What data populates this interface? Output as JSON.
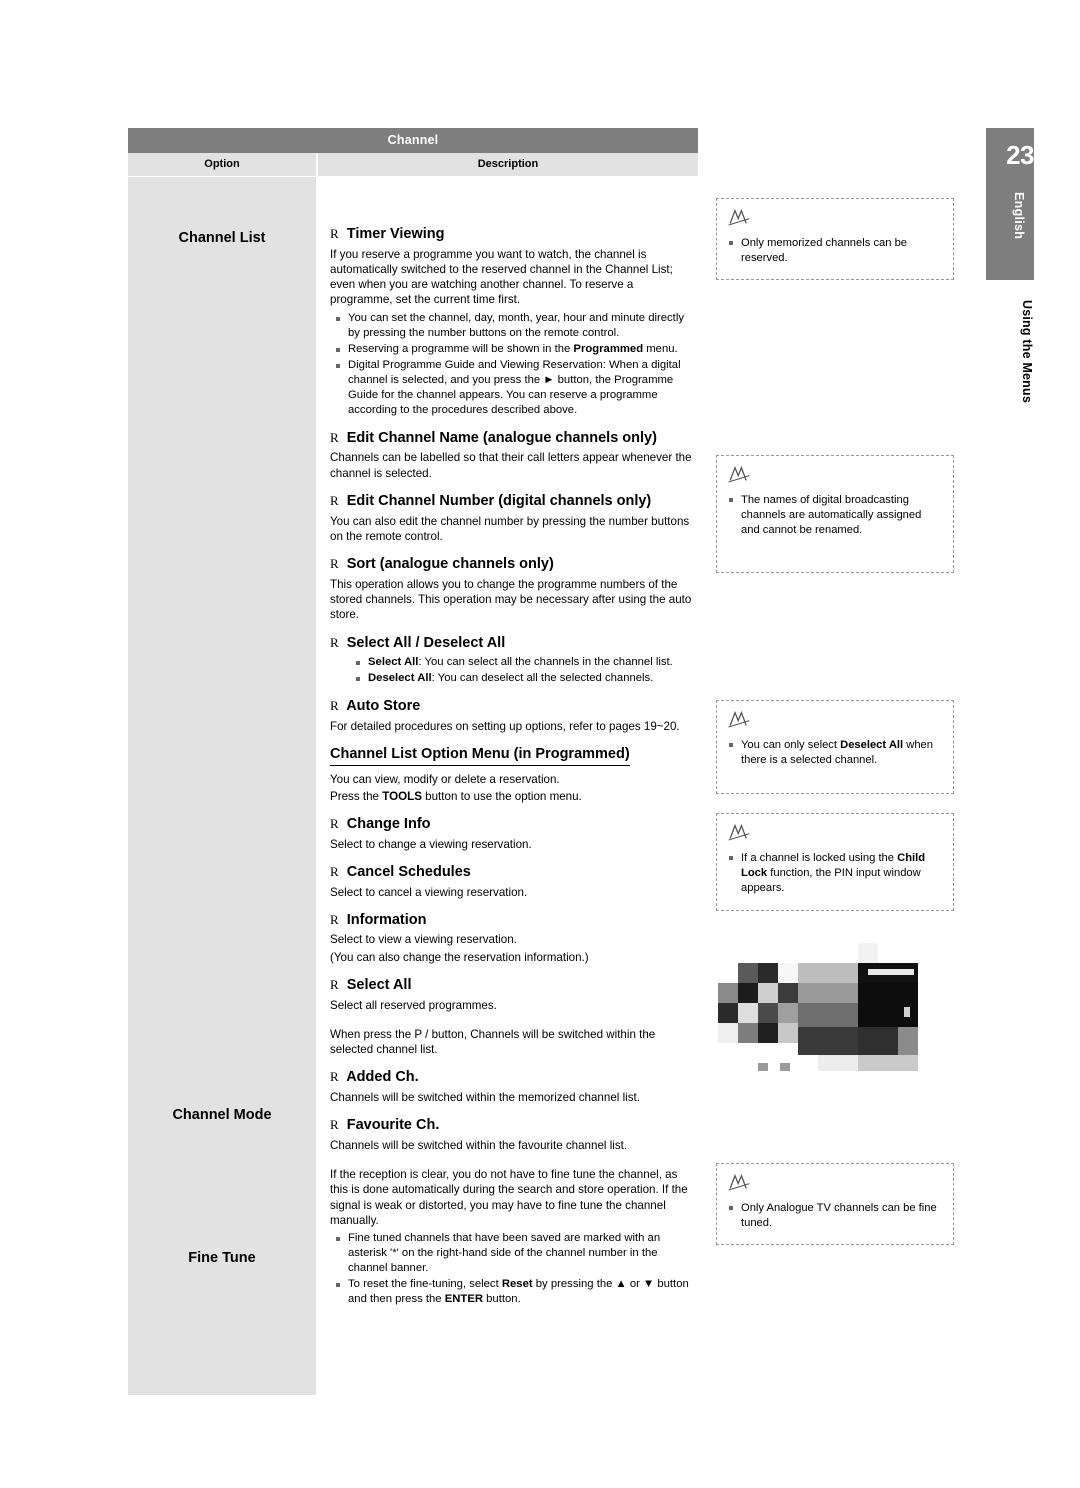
{
  "page": {
    "number": "23",
    "side_label": "English",
    "side_vertical": "Using the Menus"
  },
  "table": {
    "title": "Channel",
    "columns": {
      "option": "Option",
      "description": "Description"
    },
    "rows": [
      {
        "option": "Channel List"
      },
      {
        "option": "Channel Mode"
      },
      {
        "option": "Fine Tune"
      }
    ]
  },
  "content": {
    "timer_viewing": {
      "heading": "Timer Viewing",
      "paragraph": "If you reserve a programme you want to watch, the channel is automatically switched to the reserved channel in the Channel List; even when you are watching another channel. To reserve a programme, set the current time first.",
      "bullets": [
        "You can set the channel, day, month, year, hour and minute directly by pressing the number buttons on the remote control.",
        "Reserving a programme will be shown in the Programmed menu.",
        "Digital Programme Guide and Viewing Reservation: When a digital channel is selected, and you press the ► button, the Programme Guide for the channel appears. You can reserve a programme according to the procedures described above."
      ]
    },
    "edit_channel_name": {
      "heading": "Edit Channel Name (analogue channels only)",
      "paragraph": "Channels can be labelled so that their call letters appear whenever the channel is selected."
    },
    "edit_channel_number": {
      "heading": "Edit Channel Number (digital channels only)",
      "paragraph": "You can also edit the channel number by pressing the number buttons on the remote control."
    },
    "sort": {
      "heading": "Sort (analogue channels only)",
      "paragraph": "This operation allows you to change the programme numbers of the stored channels. This operation may be necessary after using the auto store."
    },
    "select_deselect_all": {
      "heading": "Select All / Deselect All",
      "bullets": [
        "Select All: You can select all the channels in the channel list.",
        "Deselect All: You can deselect all the selected channels."
      ]
    },
    "auto_store": {
      "heading": "Auto Store",
      "paragraph": "For detailed procedures on setting up options, refer to pages 19~20."
    },
    "option_menu": {
      "heading": "Channel List Option Menu (in Programmed)",
      "paragraph1": "You can view, modify or delete a reservation.",
      "paragraph2": "Press the TOOLS button to use the option menu."
    },
    "change_info": {
      "heading": "Change Info",
      "paragraph": "Select to change a viewing reservation."
    },
    "cancel_schedules": {
      "heading": "Cancel Schedules",
      "paragraph": "Select to cancel a viewing reservation."
    },
    "information": {
      "heading": "Information",
      "paragraph1": "Select to view a viewing reservation.",
      "paragraph2": "(You can also change the reservation information.)"
    },
    "select_all": {
      "heading": "Select All",
      "paragraph": "Select all reserved programmes."
    },
    "channel_mode": {
      "paragraph": "When press the P  /  button, Channels will be switched within the selected channel list.",
      "added_ch": {
        "heading": "Added Ch.",
        "paragraph": "Channels will be switched within the memorized channel list."
      },
      "favourite_ch": {
        "heading": "Favourite Ch.",
        "paragraph": "Channels will be switched within the favourite channel list."
      }
    },
    "fine_tune": {
      "paragraph": "If the reception is clear, you do not have to fine tune the channel, as this is done automatically during the search and store operation. If the signal is weak or distorted, you may have to fine tune the channel manually.",
      "bullets": [
        "Fine tuned channels that have been saved are marked with an asterisk '*' on the right-hand side of the channel number in the channel banner.",
        "To reset the fine-tuning, select Reset by pressing the ▲ or ▼ button and then press the ENTER  button."
      ]
    }
  },
  "notes": [
    {
      "id": "note-memorized",
      "items": [
        "Only memorized channels can be reserved."
      ]
    },
    {
      "id": "note-digital-names",
      "items": [
        "The names of digital broadcasting channels are automatically assigned and cannot be renamed."
      ]
    },
    {
      "id": "note-deselect-all",
      "items": [
        "You can only select Deselect All when there is a selected channel."
      ]
    },
    {
      "id": "note-child-lock",
      "items": [
        "If a channel is locked using the Child Lock function, the PIN input window appears."
      ]
    },
    {
      "id": "note-analogue-fine-tune",
      "items": [
        "Only Analogue TV channels can be fine tuned."
      ]
    }
  ]
}
